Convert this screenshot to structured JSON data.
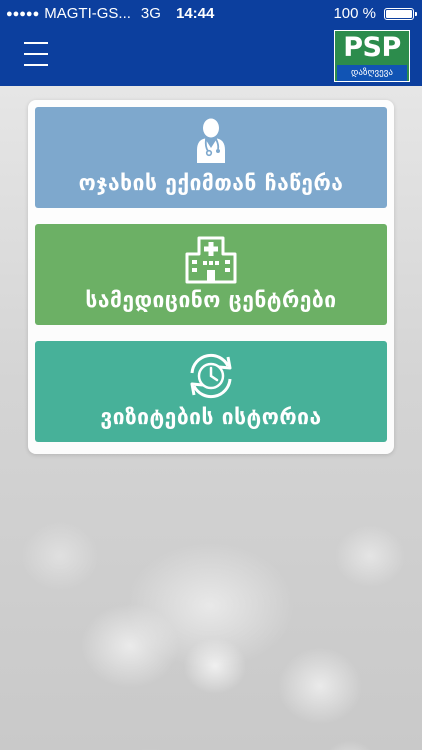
{
  "status_bar": {
    "signal": "●●●●●",
    "carrier": "MAGTI-GS...",
    "network": "3G",
    "time": "14:44",
    "battery": "100 %"
  },
  "header": {
    "logo_text": "PSP",
    "logo_subtitle": "დაზღვევა"
  },
  "menu": [
    {
      "label": "ოჯახის ექიმთან ჩაწერა",
      "icon": "doctor-icon",
      "color": "#7ea8cd"
    },
    {
      "label": "სამედიცინო ცენტრები",
      "icon": "hospital-icon",
      "color": "#6cb065"
    },
    {
      "label": "ვიზიტების ისტორია",
      "icon": "history-clock-icon",
      "color": "#47b199"
    }
  ]
}
